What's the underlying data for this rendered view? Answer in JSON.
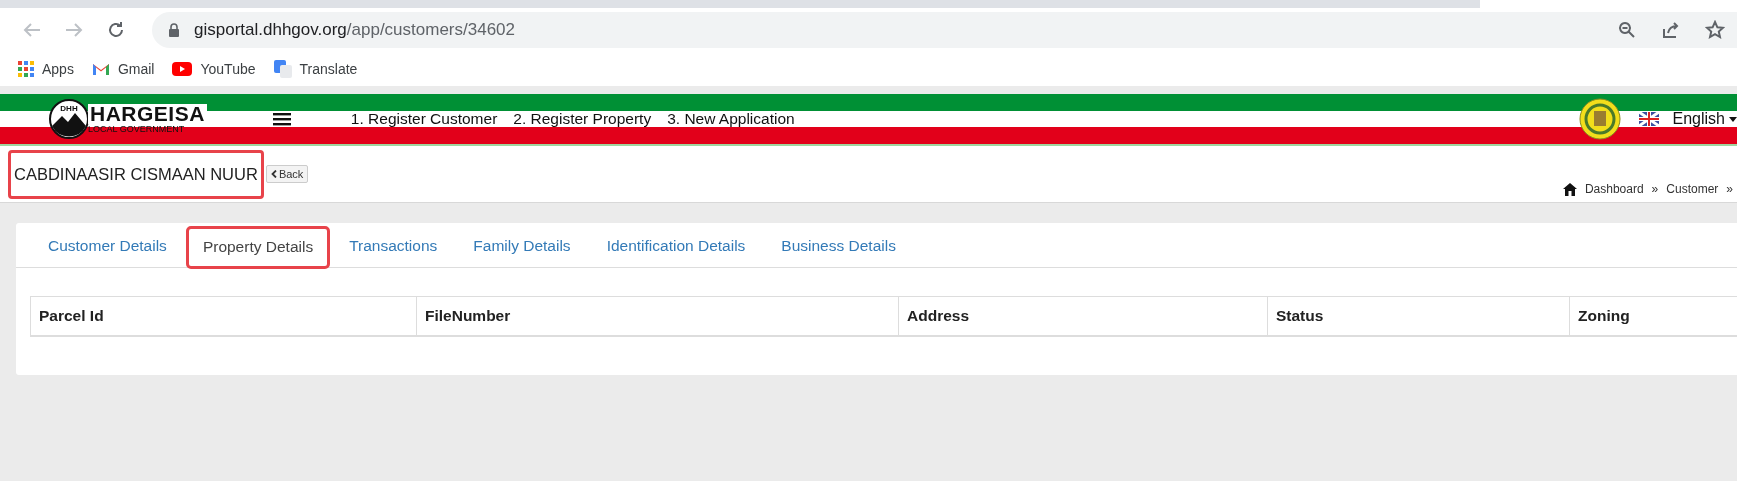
{
  "browser": {
    "url_host": "gisportal.dhhgov.org",
    "url_path": "/app/customers/34602",
    "bookmarks": [
      {
        "label": "Apps",
        "kind": "apps"
      },
      {
        "label": "Gmail",
        "kind": "gmail"
      },
      {
        "label": "YouTube",
        "kind": "youtube"
      },
      {
        "label": "Translate",
        "kind": "translate"
      }
    ]
  },
  "header": {
    "logo_title": "HARGEISA",
    "logo_subtitle": "LOCAL GOVERNMENT",
    "logo_letters": "DHH",
    "nav": [
      "1. Register Customer",
      "2. Register Property",
      "3. New Application"
    ],
    "language": "English"
  },
  "page": {
    "customer_name": "CABDINAASIR CISMAAN NUUR",
    "name_highlighted": true,
    "back_label": "Back",
    "breadcrumb": [
      "Dashboard",
      "»",
      "Customer",
      "»"
    ]
  },
  "tabs": [
    {
      "label": "Customer Details",
      "selected": false,
      "highlighted": false
    },
    {
      "label": "Property Details",
      "selected": true,
      "highlighted": true
    },
    {
      "label": "Transactions",
      "selected": false,
      "highlighted": false
    },
    {
      "label": "Family Details",
      "selected": false,
      "highlighted": false
    },
    {
      "label": "Identification Details",
      "selected": false,
      "highlighted": false
    },
    {
      "label": "Business Details",
      "selected": false,
      "highlighted": false
    }
  ],
  "table": {
    "columns": [
      "Parcel Id",
      "FileNumber",
      "Address",
      "Status",
      "Zoning"
    ]
  }
}
